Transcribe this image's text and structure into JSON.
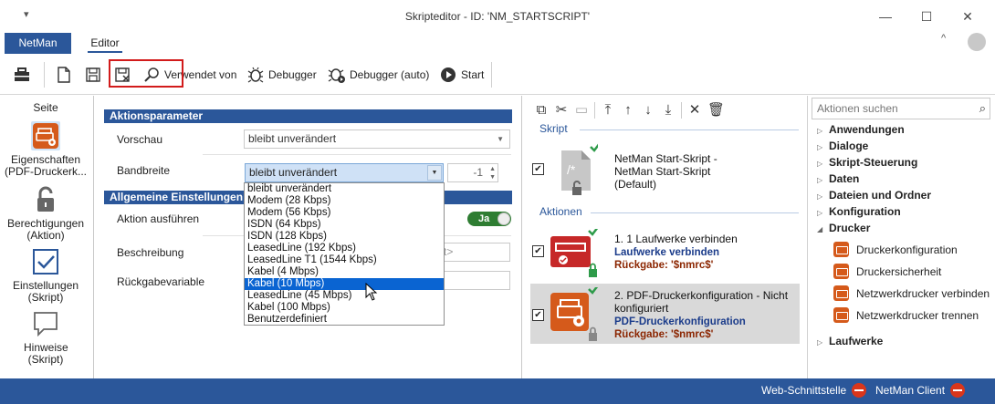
{
  "window": {
    "title": "Skripteditor - ID: 'NM_STARTSCRIPT'",
    "quick_access": "▾",
    "minimize": "—",
    "maximize": "☐",
    "close": "✕"
  },
  "ribbon": {
    "tabs": [
      {
        "label": "NetMan",
        "active": false
      },
      {
        "label": "Editor",
        "active": true
      }
    ],
    "collapse": "^"
  },
  "toolbar": {
    "used_by_label": "Verwendet von",
    "debugger_label": "Debugger",
    "debugger_auto_label": "Debugger (auto)",
    "start_label": "Start"
  },
  "left_nav": {
    "title": "Seite",
    "items": [
      {
        "label": "Eigenschaften (PDF-Druckerk...",
        "icon": "printer-settings-icon",
        "selected": true
      },
      {
        "label": "Berechtigungen (Aktion)",
        "icon": "lock-icon",
        "selected": false
      },
      {
        "label": "Einstellungen (Skript)",
        "icon": "checkbox-icon",
        "selected": false
      },
      {
        "label": "Hinweise (Skript)",
        "icon": "speech-bubble-icon",
        "selected": false
      }
    ]
  },
  "params": {
    "section_title": "Aktionsparameter",
    "preview_label": "Vorschau",
    "preview_value": "bleibt unverändert",
    "bandwidth_label": "Bandbreite",
    "bandwidth_value": "bleibt unverändert",
    "bandwidth_spin": "-1",
    "bandwidth_options": [
      "bleibt unverändert",
      "Modem (28 Kbps)",
      "Modem (56 Kbps)",
      "ISDN (64 Kbps)",
      "ISDN (128 Kbps)",
      "LeasedLine (192 Kbps)",
      "LeasedLine T1 (1544 Kbps)",
      "Kabel (4 Mbps)",
      "Kabel (10 Mbps)",
      "LeasedLine (45 Mbps)",
      "Kabel (100 Mbps)",
      "Benutzerdefiniert"
    ],
    "bandwidth_highlighted_index": 8
  },
  "general": {
    "section_title": "Allgemeine Einstellungen",
    "execute_label": "Aktion ausführen",
    "execute_toggle": "Ja",
    "description_label": "Beschreibung",
    "description_placeholder_tail": "rt>",
    "return_var_label": "Rückgabevariable"
  },
  "script_panel": {
    "script_header": "Skript",
    "script_entry": {
      "title": "NetMan Start-Skript - NetMan Start-Skript (Default)",
      "checked": true
    },
    "actions_header": "Aktionen",
    "actions": [
      {
        "title": "1. 1 Laufwerke verbinden",
        "subtitle": "Laufwerke verbinden",
        "return": "Rückgabe: '$nmrc$'",
        "checked": true,
        "selected": false
      },
      {
        "title": "2. PDF-Druckerkonfiguration - Nicht konfiguriert",
        "subtitle": "PDF-Druckerkonfiguration",
        "return": "Rückgabe: '$nmrc$'",
        "checked": true,
        "selected": true
      }
    ]
  },
  "actions_panel": {
    "search_placeholder": "Aktionen suchen",
    "categories": [
      {
        "label": "Anwendungen",
        "bold": true
      },
      {
        "label": "Dialoge"
      },
      {
        "label": "Skript-Steuerung"
      },
      {
        "label": "Daten"
      },
      {
        "label": "Dateien und Ordner"
      },
      {
        "label": "Konfiguration"
      },
      {
        "label": "Drucker",
        "expanded": true
      }
    ],
    "printer_actions": [
      "Druckerkonfiguration",
      "Druckersicherheit",
      "Netzwerkdrucker verbinden",
      "Netzwerkdrucker trennen"
    ],
    "last_category": "Laufwerke"
  },
  "statusbar": {
    "web_interface": "Web-Schnittstelle",
    "client": "NetMan Client"
  },
  "colors": {
    "accent": "#2b579a",
    "highlight": "#0a64d2",
    "error_box": "#d21b1b",
    "toggle_on": "#2e7d32"
  }
}
